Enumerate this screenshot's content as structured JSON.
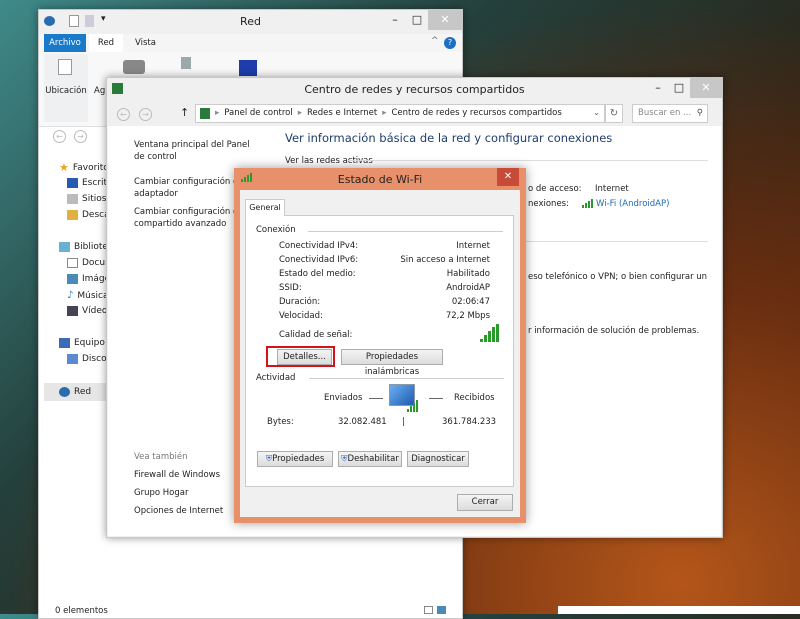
{
  "explorer": {
    "title": "Red",
    "tabs": [
      "Archivo",
      "Red",
      "Vista"
    ],
    "ribbon": {
      "location_label": "Ubicación",
      "partial_label": "Ag"
    },
    "nav": [
      "Favoritos",
      "Escritorio",
      "Sitios",
      "Descargas",
      "Bibliotecas",
      "Documentos",
      "Imágenes",
      "Música",
      "Vídeos",
      "Equipo",
      "Disco",
      "Red"
    ],
    "status": "0 elementos"
  },
  "netcenter": {
    "title": "Centro de redes y recursos compartidos",
    "breadcrumb": [
      "Panel de control",
      "Redes e Internet",
      "Centro de redes y recursos compartidos"
    ],
    "search_placeholder": "Buscar en ...",
    "left_links": [
      "Ventana principal del Panel de control",
      "Cambiar configuración del adaptador",
      "Cambiar configuración de uso compartido avanzado"
    ],
    "see_also": "Vea también",
    "see_also_links": [
      "Firewall de Windows",
      "Grupo Hogar",
      "Opciones de Internet"
    ],
    "heading": "Ver información básica de la red y configurar conexiones",
    "active_networks": "Ver las redes activas",
    "access_type_label": "o de acceso:",
    "access_type_value": "Internet",
    "connections_label": "nexiones:",
    "connections_value": "Wi-Fi (AndroidAP)",
    "text1": "eso telefónico o VPN; o bien configurar un",
    "text2": "r información de solución de problemas."
  },
  "wifi": {
    "title": "Estado de Wi-Fi",
    "tab": "General",
    "connection_label": "Conexión",
    "rows": [
      {
        "label": "Conectividad IPv4:",
        "value": "Internet"
      },
      {
        "label": "Conectividad IPv6:",
        "value": "Sin acceso a Internet"
      },
      {
        "label": "Estado del medio:",
        "value": "Habilitado"
      },
      {
        "label": "SSID:",
        "value": "AndroidAP"
      },
      {
        "label": "Duración:",
        "value": "02:06:47"
      },
      {
        "label": "Velocidad:",
        "value": "72,2 Mbps"
      }
    ],
    "signal_label": "Calidad de señal:",
    "signal_bars": 5,
    "details_button": "Detalles...",
    "wireless_props_button": "Propiedades inalámbricas",
    "activity_label": "Actividad",
    "sent_label": "Enviados",
    "received_label": "Recibidos",
    "bytes_label": "Bytes:",
    "bytes_sent": "32.082.481",
    "bytes_received": "361.784.233",
    "properties_button": "Propiedades",
    "disable_button": "Deshabilitar",
    "diagnose_button": "Diagnosticar",
    "close_button": "Cerrar",
    "highlight_color": "#d0141a",
    "frame_color": "#e8906a"
  }
}
